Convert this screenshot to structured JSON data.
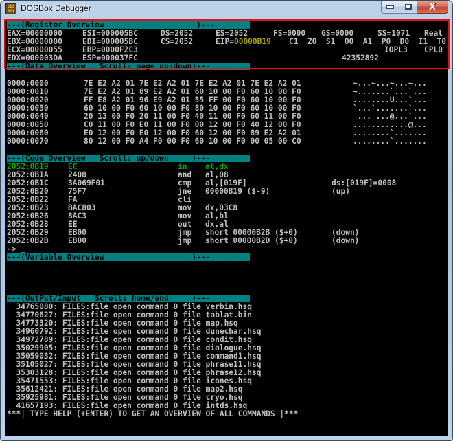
{
  "window": {
    "title": "DOSBox Debugger",
    "icon": "dosbox-icon",
    "icon_text": [
      "DOS",
      "BOX"
    ],
    "buttons": {
      "minimize": "minimize-icon",
      "maximize": "maximize-icon",
      "close": "close-icon"
    }
  },
  "colors": {
    "header_bar": "#008080",
    "text": "#c0c0c0",
    "current_line": "#00a800",
    "eip_value": "#a8a800",
    "selection_frame": "#e81010"
  },
  "registers": {
    "header": "---(Register Overview                    )---",
    "rows": [
      [
        "EAX=00000000",
        "ESI=000005BC",
        "DS=2052",
        "ES=2052",
        "FS=0000",
        "GS=0000",
        "SS=1071",
        "Real"
      ],
      [
        "EBX=00000000",
        "EDI=000005BC",
        "CS=2052"
      ],
      [
        "ECX=00000055",
        "EBP=0000F2C3"
      ],
      [
        "EDX=000003DA",
        "ESP=000037FC"
      ]
    ],
    "eip_label": "EIP=",
    "eip_value": "00000B19",
    "flags": "C1  Z0  S1  O0  A1  P0  D0  I1  T0",
    "iopl": "IOPL3",
    "cpl": "CPL0",
    "cycles": "42352892"
  },
  "data_overview": {
    "header": "---(Data Overview   Scroll: page up/down)---",
    "rows": [
      {
        "addr": "0000:0000",
        "hex": "7E E2 A2 01 7E E2 A2 01 7E E2 A2 01 7E E2 A2 01",
        "ascii": "~...~...~...~..."
      },
      {
        "addr": "0000:0010",
        "hex": "7E E2 A2 01 89 E2 A2 01 60 10 00 F0 60 10 00 F0",
        "ascii": "~.......`...`..."
      },
      {
        "addr": "0000:0020",
        "hex": "FF E8 A2 01 96 E9 A2 01 55 FF 00 F0 60 10 00 F0",
        "ascii": "........U...`..."
      },
      {
        "addr": "0000:0030",
        "hex": "60 10 00 F0 60 10 00 F0 80 10 00 F0 60 10 00 F0",
        "ascii": "`...`.......`..."
      },
      {
        "addr": "0000:0040",
        "hex": "20 13 00 F0 20 11 00 F0 40 11 00 F0 60 11 00 F0",
        "ascii": " ... ...@...`..."
      },
      {
        "addr": "0000:0050",
        "hex": "C0 11 00 F0 E0 11 00 F0 00 12 00 F0 40 12 00 F0",
        "ascii": "............@..."
      },
      {
        "addr": "0000:0060",
        "hex": "E0 12 00 F0 E0 12 00 F0 60 12 00 F0 89 E2 A2 01",
        "ascii": "........`......."
      },
      {
        "addr": "0000:0070",
        "hex": "80 12 00 F0 A4 F0 00 F0 60 10 00 F0 00 05 00 C0",
        "ascii": "........`......."
      }
    ]
  },
  "code_overview": {
    "header": "---(Code Overview   Scroll: up/down     )---",
    "rows": [
      {
        "addr": "2052:0B19",
        "bytes": "EC",
        "mnem": "in",
        "ops": "al,dx",
        "note": "",
        "current": true
      },
      {
        "addr": "2052:0B1A",
        "bytes": "2408",
        "mnem": "and",
        "ops": "al,08",
        "note": ""
      },
      {
        "addr": "2052:0B1C",
        "bytes": "3A069F01",
        "mnem": "cmp",
        "ops": "al,[019F]",
        "note": "ds:[019F]=0008"
      },
      {
        "addr": "2052:0B20",
        "bytes": "75F7",
        "mnem": "jne",
        "ops": "00000B19 ($-9)",
        "note": "(up)"
      },
      {
        "addr": "2052:0B22",
        "bytes": "FA",
        "mnem": "cli",
        "ops": "",
        "note": ""
      },
      {
        "addr": "2052:0B23",
        "bytes": "BAC803",
        "mnem": "mov",
        "ops": "dx,03C8",
        "note": ""
      },
      {
        "addr": "2052:0B26",
        "bytes": "8AC3",
        "mnem": "mov",
        "ops": "al,bl",
        "note": ""
      },
      {
        "addr": "2052:0B28",
        "bytes": "EE",
        "mnem": "out",
        "ops": "dx,al",
        "note": ""
      },
      {
        "addr": "2052:0B29",
        "bytes": "EB00",
        "mnem": "jmp",
        "ops": "short 00000B2B ($+0)",
        "note": "(down)"
      },
      {
        "addr": "2052:0B2B",
        "bytes": "EB00",
        "mnem": "jmp",
        "ops": "short 00000B2D ($+0)",
        "note": "(down)"
      }
    ],
    "prompt": "-> _"
  },
  "variable_overview": {
    "header": "---(Variable Overview                   )---"
  },
  "output": {
    "header": "---(OutPut/Input   Scroll: home/end     )---",
    "lines": [
      "  34765080: FILES:file open command 0 file verbin.hsq",
      "  34770627: FILES:file open command 0 file tablat.bin",
      "  34773320: FILES:file open command 0 file map.hsq",
      "  34960792: FILES:file open command 0 file dunechar.hsq",
      "  34972789: FILES:file open command 0 file condit.hsq",
      "  35029905: FILES:file open command 0 file dialogue.hsq",
      "  35059032: FILES:file open command 0 file command1.hsq",
      "  35105027: FILES:file open command 0 file phrase11.hsq",
      "  35303128: FILES:file open command 0 file phrase12.hsq",
      "  35471553: FILES:file open command 0 file icones.hsq",
      "  35612421: FILES:file open command 0 file map2.hsq",
      "  35925981: FILES:file open command 0 file cryo.hsq",
      "  41657193: FILES:file open command 0 file intds.hsq"
    ],
    "help": "***| TYPE HELP (+ENTER) TO GET AN OVERVIEW OF ALL COMMANDS |***"
  }
}
